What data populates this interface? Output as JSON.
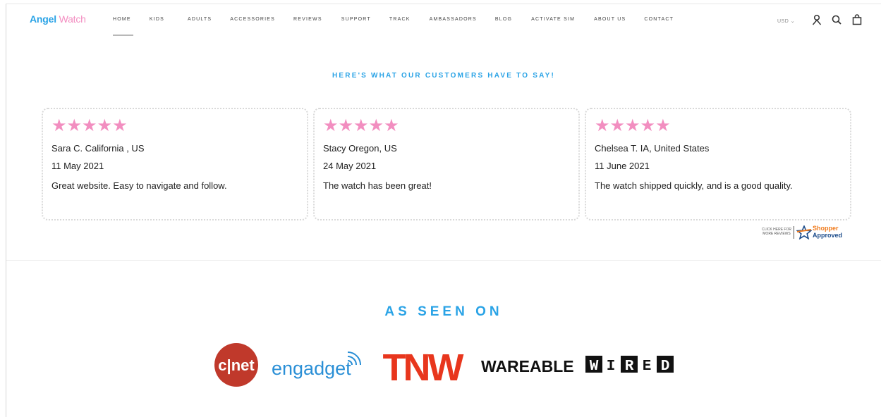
{
  "header": {
    "logo": {
      "part1": "Angel",
      "part2": " Watch"
    },
    "nav": [
      {
        "label": "HOME",
        "active": true
      },
      {
        "label": "KIDS"
      },
      {
        "label": "ADULTS"
      },
      {
        "label": "ACCESSORIES"
      },
      {
        "label": "REVIEWS"
      },
      {
        "label": "SUPPORT"
      },
      {
        "label": "TRACK"
      },
      {
        "label": "AMBASSADORS"
      },
      {
        "label": "BLOG"
      },
      {
        "label": "ACTIVATE SIM"
      },
      {
        "label": "ABOUT US"
      },
      {
        "label": "CONTACT"
      }
    ],
    "currency": "USD ⌄",
    "icons": [
      "account-icon",
      "search-icon",
      "cart-icon"
    ]
  },
  "reviews": {
    "title": "HERE'S WHAT OUR CUSTOMERS HAVE TO SAY!",
    "items": [
      {
        "stars": "★★★★★",
        "name": "Sara C. California , US",
        "date": "11 May 2021",
        "text": "Great website. Easy to navigate and follow."
      },
      {
        "stars": "★★★★★",
        "name": "Stacy Oregon, US",
        "date": "24 May 2021",
        "text": "The watch has been great!"
      },
      {
        "stars": "★★★★★",
        "name": "Chelsea T. IA, United States",
        "date": "11 June 2021",
        "text": "The watch shipped quickly, and is a good quality."
      }
    ],
    "shopper_approved": {
      "click_text_1": "CLICK HERE FOR",
      "click_text_2": "MORE REVIEWS",
      "brand_1": "Shopper",
      "brand_2": "Approved"
    }
  },
  "seen_on": {
    "title": "AS SEEN ON",
    "logos": {
      "cnet": "c|net",
      "engadget": "engadget",
      "tnw": "TNW",
      "wareable": "WAREABLE",
      "wired": [
        "W",
        "I",
        "R",
        "E",
        "D"
      ]
    }
  },
  "colors": {
    "accent_blue": "#2aa3e6",
    "star_pink": "#f28ec0",
    "cnet_red": "#c0392b",
    "tnw_red": "#e8361d",
    "shopper_orange": "#f07b1d",
    "shopper_navy": "#1b4b8a"
  }
}
